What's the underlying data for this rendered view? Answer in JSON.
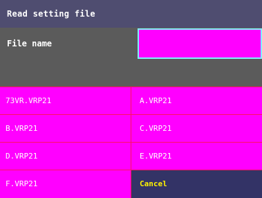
{
  "dialog": {
    "title": "Read setting file",
    "filename_label": "File name",
    "filename_value": ""
  },
  "files": [
    "73VR.VRP21",
    "A.VRP21",
    "B.VRP21",
    "C.VRP21",
    "D.VRP21",
    "E.VRP21",
    "F.VRP21"
  ],
  "cancel_label": "Cancel",
  "colors": {
    "title_bar": "#4f4d70",
    "panel": "#5b5b5b",
    "file_cell": "#ff00ff",
    "cell_border": "#ff1060",
    "input_border": "#7ff0ff",
    "cancel_bg": "#333366",
    "cancel_text": "#fff200"
  }
}
